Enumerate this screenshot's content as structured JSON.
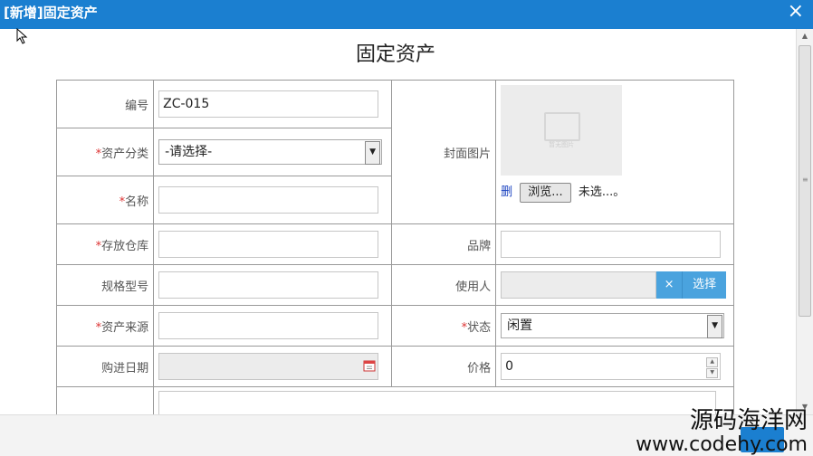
{
  "window": {
    "title": "[新增]固定资产",
    "close": "×"
  },
  "form": {
    "title": "固定资产",
    "required_mark": "*",
    "fields": {
      "code": {
        "label": "编号",
        "value": "ZC-015"
      },
      "category": {
        "label": "资产分类",
        "value": "-请选择-"
      },
      "name": {
        "label": "名称",
        "value": ""
      },
      "warehouse": {
        "label": "存放仓库",
        "value": ""
      },
      "spec": {
        "label": "规格型号",
        "value": ""
      },
      "source": {
        "label": "资产来源",
        "value": ""
      },
      "purchase_date": {
        "label": "购进日期",
        "value": ""
      },
      "cover": {
        "label": "封面图片",
        "placeholder_caption": "暂无图片",
        "delete": "删",
        "browse": "浏览...",
        "file_status": "未选...。"
      },
      "brand": {
        "label": "品牌",
        "value": ""
      },
      "user": {
        "label": "使用人",
        "value": "",
        "clear": "×",
        "pick": "选择"
      },
      "status": {
        "label": "状态",
        "value": "闲置"
      },
      "price": {
        "label": "价格",
        "value": "0"
      }
    }
  },
  "watermark": {
    "line1": "源码海洋网",
    "line2": "www.codehy.com"
  },
  "colors": {
    "titlebar": "#1b7fd0",
    "button": "#4aa3de",
    "required": "#d33333"
  }
}
